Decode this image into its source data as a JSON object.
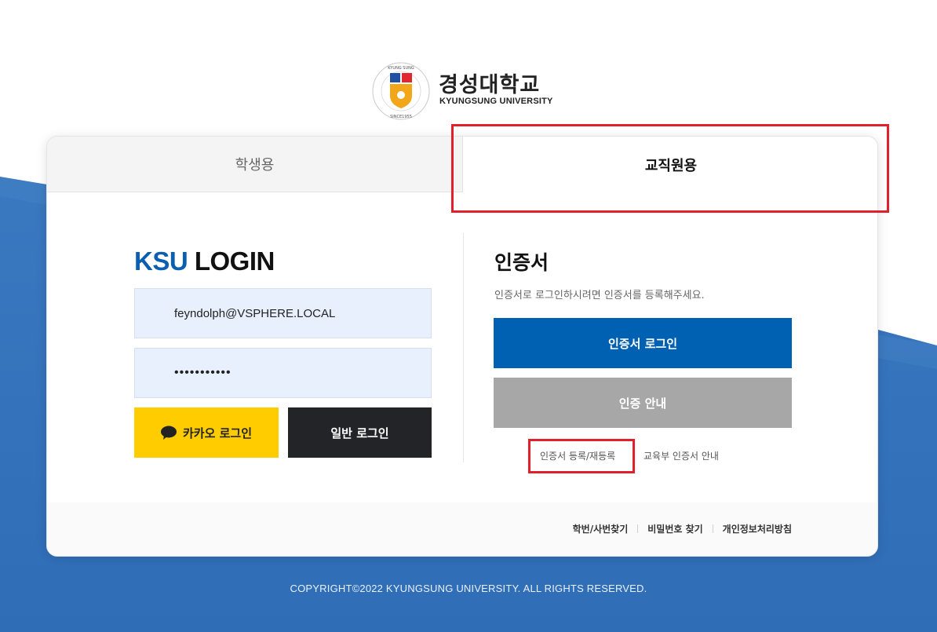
{
  "logo": {
    "korean_name": "경성대학교",
    "english_name": "KYUNGSUNG UNIVERSITY",
    "seal_text": "KYUNG SUNG UNIVERSITY · SINCE1955"
  },
  "tabs": {
    "student": "학생용",
    "staff": "교직원용",
    "active": "staff"
  },
  "login": {
    "title_ksu": "KSU",
    "title_login": "LOGIN",
    "username_value": "feyndolph@VSPHERE.LOCAL",
    "password_value": "•••••••••••",
    "kakao_button": "카카오 로그인",
    "general_button": "일반 로그인"
  },
  "certificate": {
    "title": "인증서",
    "description": "인증서로 로그인하시려면 인증서를 등록해주세요.",
    "login_button": "인증서 로그인",
    "guide_button": "인증 안내",
    "register_link": "인증서 등록/재등록",
    "moe_link": "교육부 인증서 안내"
  },
  "footer_links": [
    "학번/사번찾기",
    "비밀번호 찾기",
    "개인정보처리방침"
  ],
  "copyright": "COPYRIGHT©2022 KYUNGSUNG UNIVERSITY. ALL RIGHTS RESERVED.",
  "colors": {
    "brand_blue": "#0a5fb0",
    "cert_button": "#0061b3",
    "kakao_yellow": "#ffcc00",
    "highlight_red": "#e0202a"
  }
}
